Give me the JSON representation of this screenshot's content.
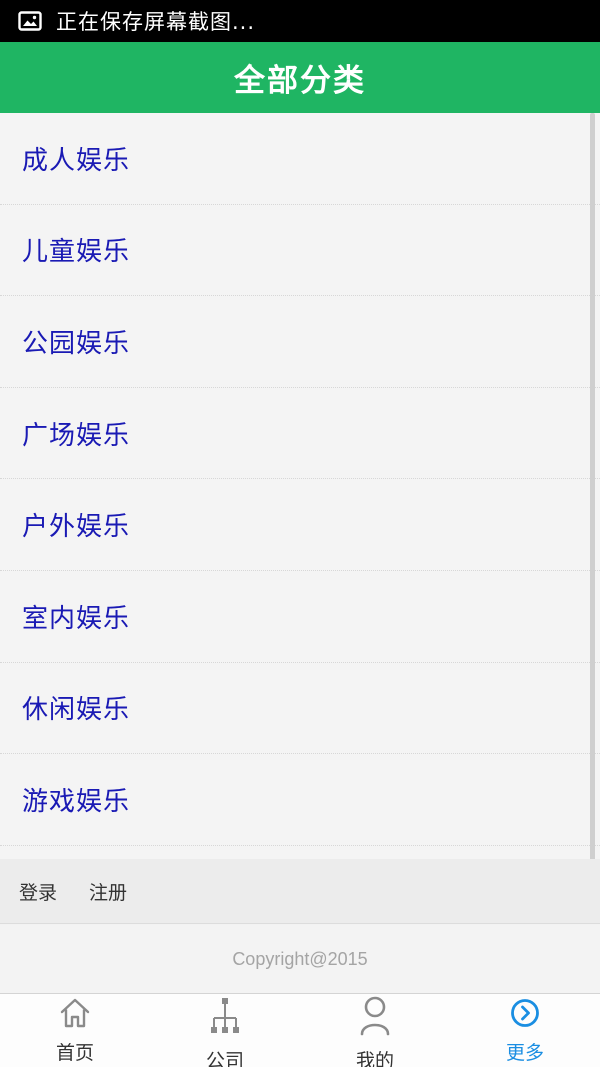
{
  "status_bar": {
    "notification_icon": "screenshot-image-icon",
    "text": "正在保存屏幕截图..."
  },
  "header": {
    "title": "全部分类",
    "bg_color": "#1fb563"
  },
  "categories": [
    {
      "label": "成人娱乐"
    },
    {
      "label": "儿童娱乐"
    },
    {
      "label": "公园娱乐"
    },
    {
      "label": "广场娱乐"
    },
    {
      "label": "户外娱乐"
    },
    {
      "label": "室内娱乐"
    },
    {
      "label": "休闲娱乐"
    },
    {
      "label": "游戏娱乐"
    }
  ],
  "category_text_color": "#1a1ab4",
  "auth": {
    "login_label": "登录",
    "register_label": "注册"
  },
  "footer": {
    "copyright": "Copyright@2015"
  },
  "bottom_nav": {
    "active_color": "#1a8ee2",
    "items": [
      {
        "label": "首页",
        "icon": "home-icon",
        "active": false
      },
      {
        "label": "公司",
        "icon": "org-chart-icon",
        "active": false
      },
      {
        "label": "我的",
        "icon": "user-icon",
        "active": false
      },
      {
        "label": "更多",
        "icon": "chevron-circle-right-icon",
        "active": true
      }
    ]
  }
}
